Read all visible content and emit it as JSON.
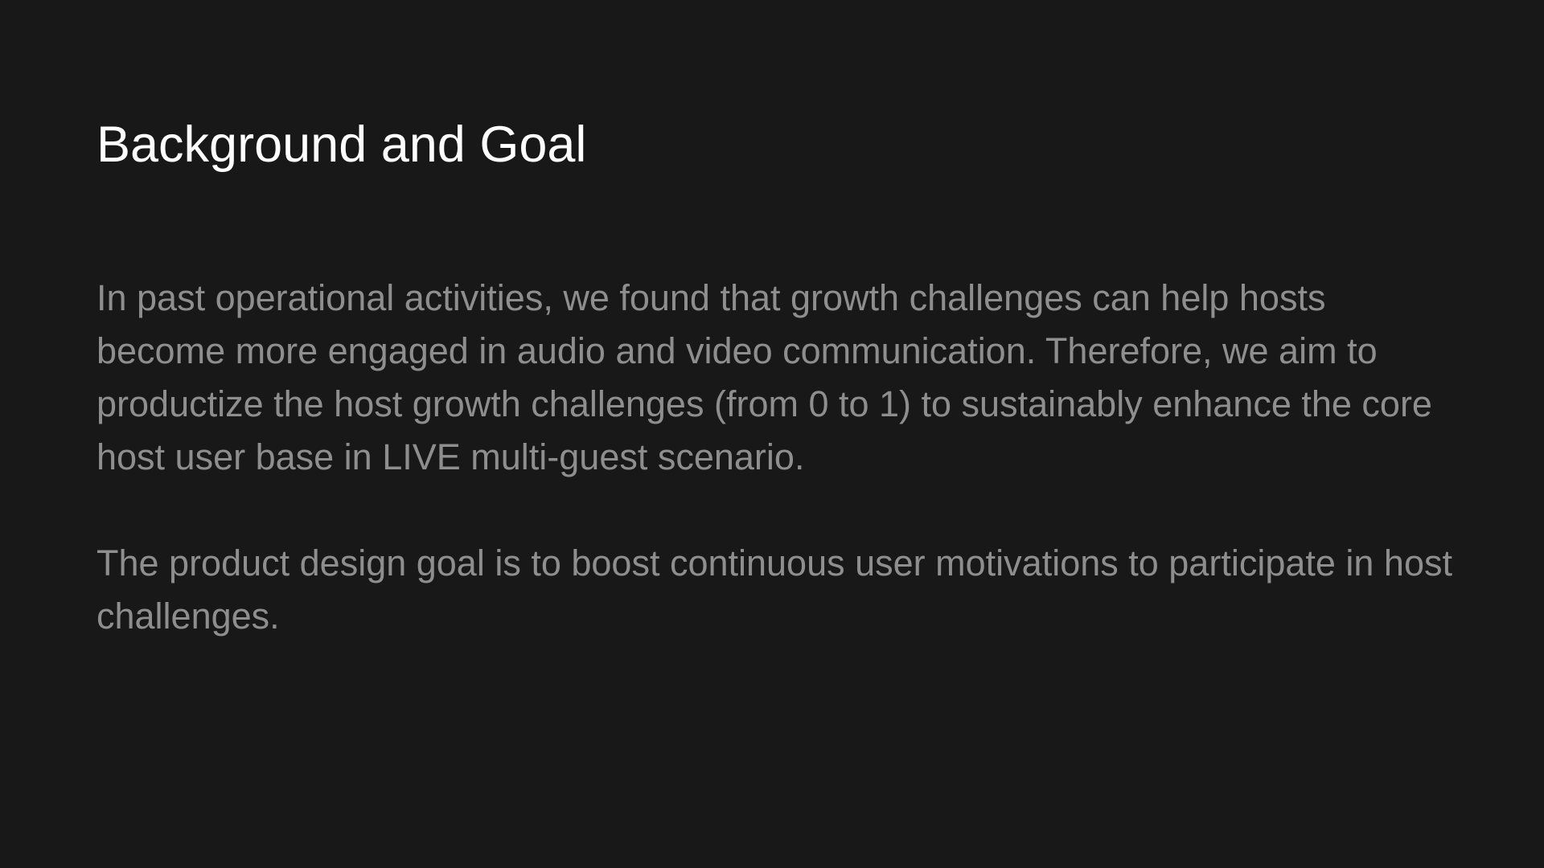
{
  "slide": {
    "title": "Background and Goal",
    "paragraphs": [
      "In past operational activities, we found that growth challenges can help hosts become more engaged in audio and video communication. Therefore, we aim to productize the host growth challenges (from 0 to 1) to sustainably enhance the core host user base in LIVE multi-guest scenario.",
      "The product design goal is to boost continuous user motivations to participate in host challenges."
    ]
  },
  "colors": {
    "background": "#181818",
    "title": "#ffffff",
    "body": "#8e8e8e"
  }
}
